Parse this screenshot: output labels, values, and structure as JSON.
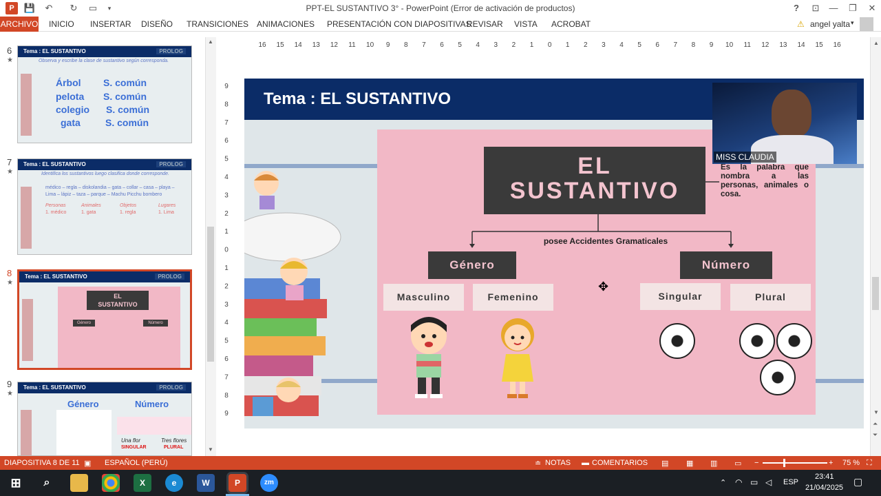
{
  "window": {
    "title": "PPT-EL SUSTANTIVO 3° - PowerPoint (Error de activación de productos)",
    "user": "angel yalta",
    "help": "?"
  },
  "ribbon": {
    "tabs": [
      "ARCHIVO",
      "INICIO",
      "INSERTAR",
      "DISEÑO",
      "TRANSICIONES",
      "ANIMACIONES",
      "PRESENTACIÓN CON DIAPOSITIVAS",
      "REVISAR",
      "VISTA",
      "ACROBAT"
    ]
  },
  "thumbnails": [
    {
      "num": "6",
      "header": "Tema : EL SUSTANTIVO",
      "brand": "PROLOG",
      "subtitle": "Observa y escribe la clase de sustantivo según corresponda.",
      "words": [
        "Árbol",
        "pelota",
        "colegio",
        "gata"
      ],
      "types": [
        "S. común",
        "S. común",
        "S. común",
        "S. común"
      ]
    },
    {
      "num": "7",
      "header": "Tema : EL SUSTANTIVO",
      "brand": "PROLOG",
      "subtitle": "Identifica los sustantivos luego clasifica donde corresponde.",
      "line1": "médico – regla – diskolandia – gata – collar – casa – playa –",
      "line2": "Lima – lápiz – taza – parque – Machu Picchu bombero",
      "cols": [
        "Personas",
        "Animales",
        "Objetos",
        "Lugares"
      ],
      "firsts": [
        "1. médico",
        "1. gata",
        "1. regla",
        "1. Lima"
      ]
    },
    {
      "num": "8",
      "header": "Tema : EL SUSTANTIVO",
      "brand": "PROLOG",
      "selected": true
    },
    {
      "num": "9",
      "header": "Tema : EL SUSTANTIVO",
      "brand": "PROLOG",
      "labels": [
        "Género",
        "Número"
      ],
      "cap1": "Una flor",
      "cap1b": "SINGULAR",
      "cap2": "Tres flores",
      "cap2b": "PLURAL"
    }
  ],
  "ruler": {
    "h": [
      "16",
      "15",
      "14",
      "13",
      "12",
      "11",
      "10",
      "9",
      "8",
      "7",
      "6",
      "5",
      "4",
      "3",
      "2",
      "1",
      "0",
      "1",
      "2",
      "3",
      "4",
      "5",
      "6",
      "7",
      "8",
      "9",
      "10",
      "11",
      "12",
      "13",
      "14",
      "15",
      "16"
    ],
    "v": [
      "9",
      "8",
      "7",
      "6",
      "5",
      "4",
      "3",
      "2",
      "1",
      "0",
      "1",
      "2",
      "3",
      "4",
      "5",
      "6",
      "7",
      "8",
      "9"
    ]
  },
  "slide": {
    "title": "Tema : EL SUSTANTIVO",
    "main_box": "EL SUSTANTIVO",
    "main_line1": "EL",
    "main_line2": "SUSTANTIVO",
    "definition": "Es la palabra que nombra a las personas, animales o cosa.",
    "connector": "posee Accidentes Gramaticales",
    "genero": "Género",
    "numero": "Número",
    "masculino": "Masculino",
    "femenino": "Femenino",
    "singular": "Singular",
    "plural": "Plural"
  },
  "webcam": {
    "name": "MISS CLAUDIA"
  },
  "status": {
    "slide": "DIAPOSITIVA 8 DE 11",
    "lang": "ESPAÑOL (PERÚ)",
    "notes": "NOTAS",
    "comments": "COMENTARIOS",
    "zoom": "75 %"
  },
  "taskbar": {
    "lang": "ESP",
    "time": "23:41",
    "date": "21/04/2025"
  },
  "colors": {
    "accent": "#d24726",
    "navy": "#0b2c67",
    "pink": "#f2b8c6"
  }
}
